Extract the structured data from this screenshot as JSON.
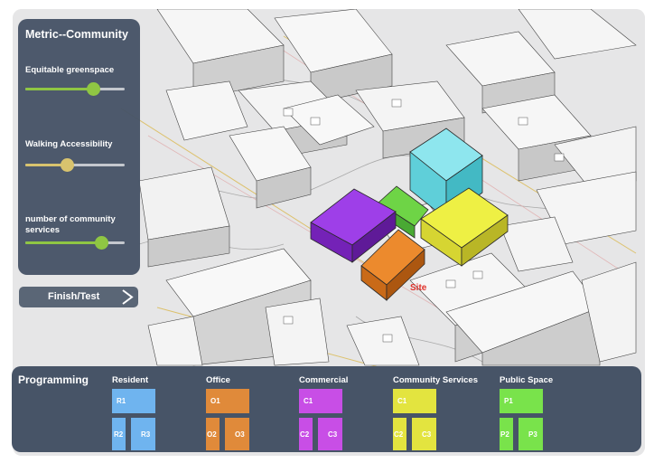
{
  "metric_panel": {
    "title": "Metric--Community",
    "sliders": [
      {
        "label": "Equitable greenspace",
        "value": 0.68,
        "color": "#8cc53d"
      },
      {
        "label": "Walking Accessibility",
        "value": 0.42,
        "color": "#d8c26a"
      },
      {
        "label": "number of community services",
        "value": 0.76,
        "color": "#8cc53d"
      }
    ]
  },
  "finish_button": {
    "label": "Finish/Test",
    "icon": "chevron-right-icon"
  },
  "map": {
    "site_label": "Site",
    "site_label_color": "#e0322b"
  },
  "programming": {
    "title": "Programming",
    "categories": [
      {
        "label": "Resident",
        "color": "#6fb4ef",
        "blocks": [
          "R1",
          "R2",
          "R3"
        ]
      },
      {
        "label": "Office",
        "color": "#e08a3a",
        "blocks": [
          "O1",
          "O2",
          "O3"
        ]
      },
      {
        "label": "Commercial",
        "color": "#c84ee6",
        "blocks": [
          "C1",
          "C2",
          "C3"
        ]
      },
      {
        "label": "Community Services",
        "color": "#e3e43f",
        "blocks": [
          "C1",
          "C2",
          "C3"
        ]
      },
      {
        "label": "Public Space",
        "color": "#79e34b",
        "blocks": [
          "P1",
          "P2",
          "P3"
        ]
      }
    ]
  }
}
